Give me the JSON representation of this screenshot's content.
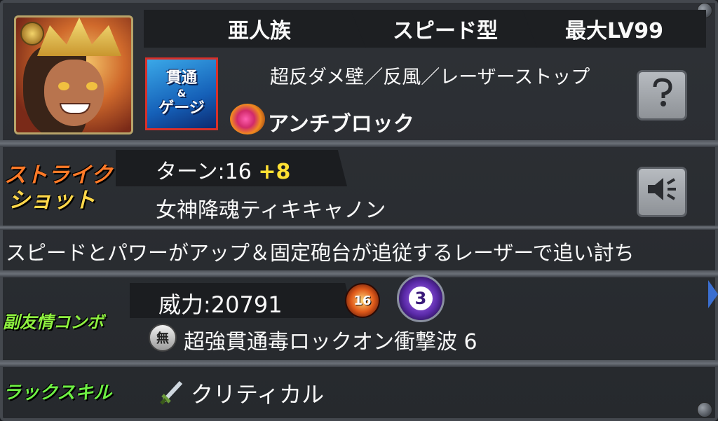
{
  "header": {
    "race": "亜人族",
    "type": "スピード型",
    "max_level": "最大LV99"
  },
  "gauge": {
    "line1": "貫通",
    "line2": "&",
    "line3": "ゲージ"
  },
  "abilities": {
    "main": "超反ダメ壁／反風／レーザーストップ",
    "gauge_ability": "アンチブロック"
  },
  "buttons": {
    "help_icon": "question-icon",
    "voice_icon": "speaker-icon"
  },
  "strike_shot": {
    "label_line1": "ストライク",
    "label_line2": "ショット",
    "turn_label": "ターン:16",
    "turn_bonus": "+8",
    "name": "女神降魂ティキキャノン",
    "description": "スピードとパワーがアップ＆固定砲台が追従するレーザーで追い討ち"
  },
  "sub_combo": {
    "label": "副友情コンボ",
    "power": "威力:20791",
    "badge_level": "16",
    "badge_count": "3",
    "element_badge": "無",
    "name": "超強貫通毒ロックオン衝撃波 6"
  },
  "luck_skill": {
    "label": "ラックスキル",
    "name": "クリティカル"
  },
  "colors": {
    "strike_label": "#ff7a28",
    "turn_bonus": "#ffe033",
    "combo_label": "#8ef040",
    "luck_label": "#6ef044"
  }
}
